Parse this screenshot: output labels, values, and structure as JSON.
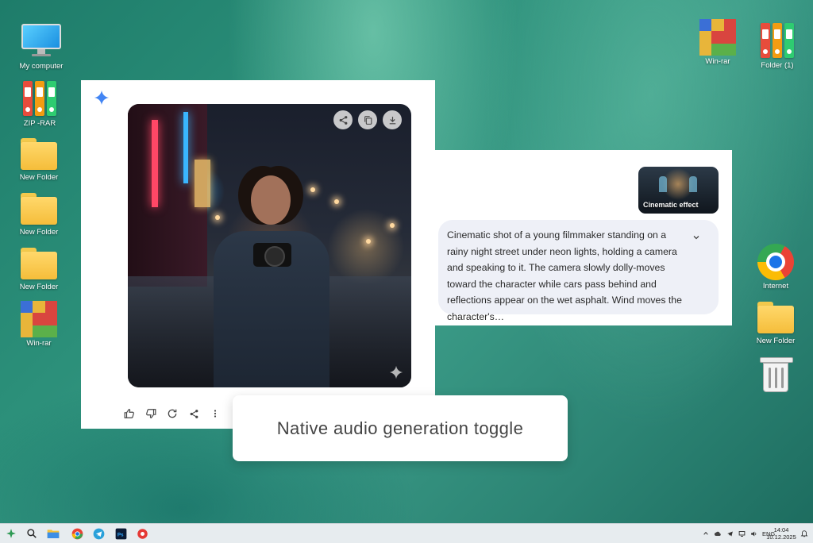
{
  "desktop": {
    "left_icons": [
      {
        "label": "My computer",
        "icon": "computer-icon"
      },
      {
        "label": "ZIP -RAR",
        "icon": "binders-icon"
      },
      {
        "label": "New Folder",
        "icon": "folder-icon"
      },
      {
        "label": "New Folder",
        "icon": "folder-icon"
      },
      {
        "label": "New Folder",
        "icon": "folder-icon"
      },
      {
        "label": "Win-rar",
        "icon": "winrar-icon"
      }
    ],
    "right_icons": [
      {
        "label": "Win-rar",
        "icon": "winrar-icon"
      },
      {
        "label": "Folder (1)",
        "icon": "binders-icon"
      },
      {
        "label": "Internet",
        "icon": "chrome-icon"
      },
      {
        "label": "New Folder",
        "icon": "folder-icon"
      },
      {
        "label": "",
        "icon": "recycle-bin-icon"
      }
    ]
  },
  "gemini_card": {
    "logo_icon": "gemini-spark-icon",
    "image_actions": [
      "share-icon",
      "copy-icon",
      "download-icon"
    ],
    "feedback_actions": [
      "thumbs-up-icon",
      "thumbs-down-icon",
      "regenerate-icon",
      "share-icon",
      "more-vert-icon"
    ]
  },
  "prompt_card": {
    "thumbnail_label": "Cinematic effect",
    "prompt_text": "Cinematic shot of a young filmmaker standing on a rainy night street under neon lights, holding a camera and speaking to it. The camera slowly dolly-moves toward the character while cars pass behind and reflections appear on the wet asphalt. Wind moves the character's…"
  },
  "caption": {
    "text": "Native audio generation toggle"
  },
  "taskbar": {
    "apps": [
      "start-icon",
      "search-icon",
      "file-explorer-icon",
      "chrome-icon",
      "telegram-icon",
      "photoshop-icon",
      "app-icon"
    ],
    "language": "ENG",
    "time": "14:04",
    "date": "10.12.2025"
  },
  "colors": {
    "gemini_blue": "#4285f4",
    "bubble_bg": "#eef0f7",
    "taskbar_bg": "#e7ecef"
  }
}
